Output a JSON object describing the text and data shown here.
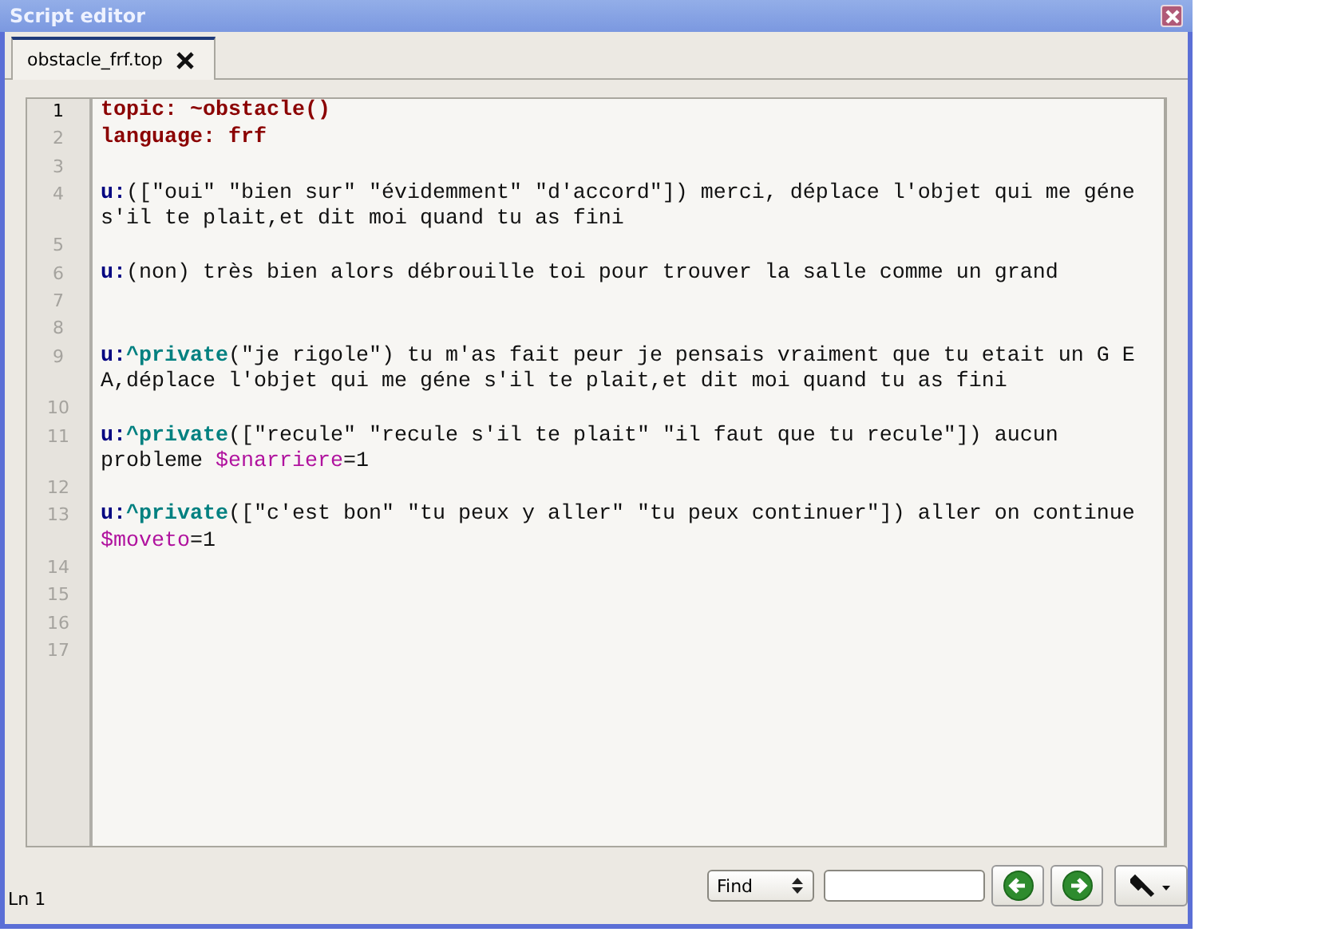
{
  "window": {
    "title": "Script editor"
  },
  "tabs": [
    {
      "label": "obstacle_frf.top",
      "selected": true
    }
  ],
  "editor": {
    "lines": [
      {
        "number": "1",
        "current": true,
        "segments": [
          {
            "kind": "header",
            "text": "topic: ~obstacle()"
          }
        ]
      },
      {
        "number": "2",
        "current": false,
        "segments": [
          {
            "kind": "header",
            "text": "language: frf"
          }
        ]
      },
      {
        "number": "3",
        "current": false
      },
      {
        "number": "4",
        "current": false,
        "segments": [
          {
            "kind": "label",
            "text": "u:"
          },
          {
            "kind": "text",
            "text": "([\"oui\" \"bien sur\" \"évidemment\" \"d'accord\"]) merci, déplace l'objet qui me géne s'il te plait,et dit moi quand tu as fini"
          }
        ]
      },
      {
        "number": "5",
        "current": false
      },
      {
        "number": "6",
        "current": false,
        "segments": [
          {
            "kind": "label",
            "text": "u:"
          },
          {
            "kind": "text",
            "text": "(non) très bien alors débrouille toi pour trouver la salle comme un grand"
          }
        ]
      },
      {
        "number": "7",
        "current": false
      },
      {
        "number": "8",
        "current": false
      },
      {
        "number": "9",
        "current": false,
        "segments": [
          {
            "kind": "label",
            "text": "u:"
          },
          {
            "kind": "function",
            "text": "^private"
          },
          {
            "kind": "text",
            "text": "(\"je rigole\") tu m'as fait peur je pensais vraiment que tu etait un G E A,déplace l'objet qui me géne s'il te plait,et dit moi quand tu as fini"
          }
        ]
      },
      {
        "number": "10",
        "current": false
      },
      {
        "number": "11",
        "current": false,
        "segments": [
          {
            "kind": "label",
            "text": "u:"
          },
          {
            "kind": "function",
            "text": "^private"
          },
          {
            "kind": "text",
            "text": "([\"recule\" \"recule s'il te plait\" \"il faut que tu recule\"]) aucun probleme "
          },
          {
            "kind": "variable",
            "text": "$enarriere"
          },
          {
            "kind": "text",
            "text": "=1"
          }
        ]
      },
      {
        "number": "12",
        "current": false
      },
      {
        "number": "13",
        "current": false,
        "segments": [
          {
            "kind": "label",
            "text": "u:"
          },
          {
            "kind": "function",
            "text": "^private"
          },
          {
            "kind": "text",
            "text": "([\"c'est bon\" \"tu peux y aller\" \"tu peux continuer\"]) aller on continue "
          },
          {
            "kind": "variable",
            "text": "$moveto"
          },
          {
            "kind": "text",
            "text": "=1"
          }
        ]
      },
      {
        "number": "14",
        "current": false
      },
      {
        "number": "15",
        "current": false
      },
      {
        "number": "16",
        "current": false
      },
      {
        "number": "17",
        "current": false
      }
    ]
  },
  "status_bar": {
    "position": "Ln 1",
    "find_mode": "Find"
  }
}
